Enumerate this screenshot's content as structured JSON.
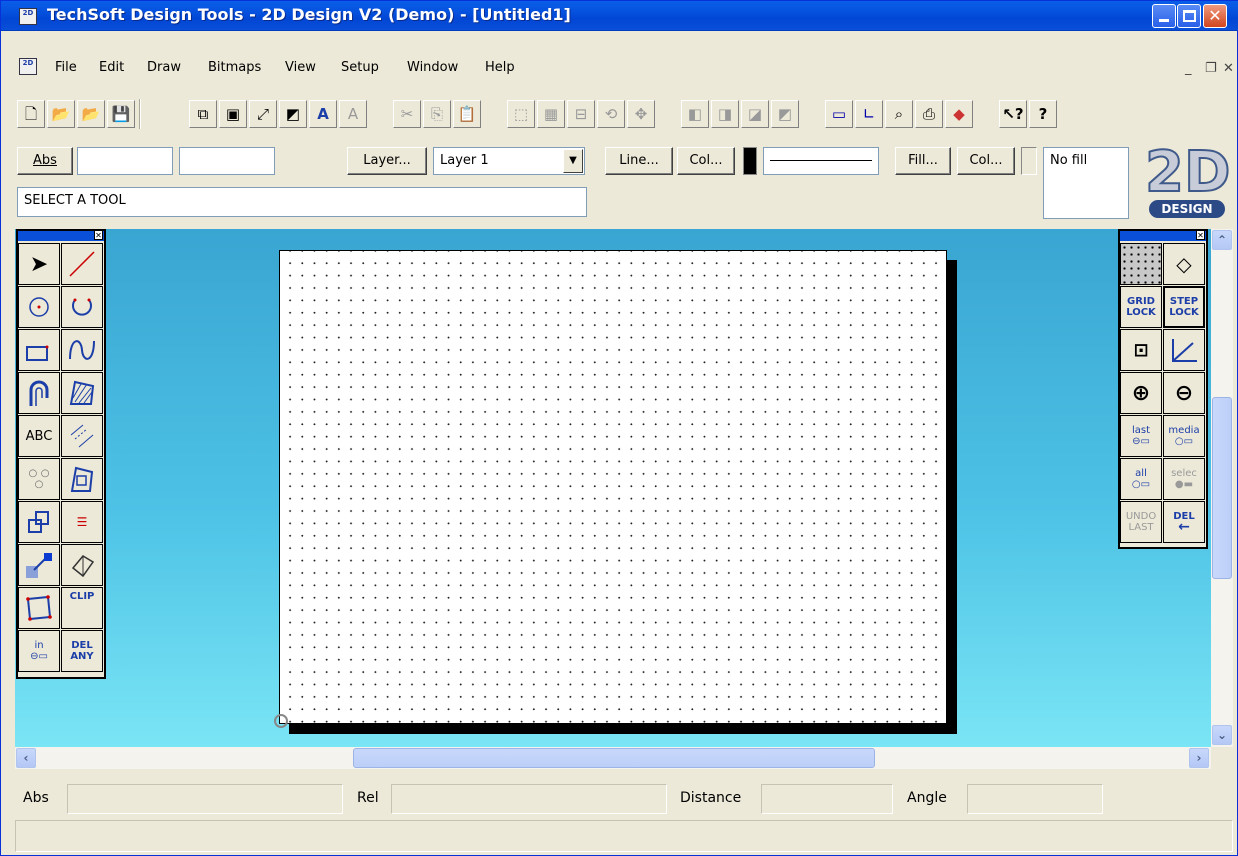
{
  "window": {
    "title": "TechSoft Design Tools - 2D Design V2 (Demo) - [Untitled1]",
    "app_icon": "2D"
  },
  "menu": {
    "items": [
      "File",
      "Edit",
      "Draw",
      "Bitmaps",
      "View",
      "Setup",
      "Window",
      "Help"
    ]
  },
  "toolbar": {
    "icons": [
      "new-file-icon",
      "open-file-icon",
      "open-add-icon",
      "save-icon",
      "zoom-window-icon",
      "zoom-fit-icon",
      "zoom-in-icon",
      "zoom-extents-icon",
      "text-icon",
      "text-disabled-icon",
      "cut-icon",
      "copy-icon",
      "paste-icon",
      "select-all-icon",
      "grid-icon",
      "align-icon",
      "rotate-icon",
      "move-icon",
      "layer-front-icon",
      "layer-back-icon",
      "layer-up-icon",
      "layer-down-icon",
      "screen-icon",
      "axes-icon",
      "magnify-icon",
      "print-icon",
      "export-icon",
      "help-pointer-icon",
      "help-icon"
    ]
  },
  "props": {
    "abs_label": "Abs",
    "x_value": "",
    "y_value": "",
    "layer_button": "Layer...",
    "layer_value": "Layer 1",
    "line_button": "Line...",
    "line_col_button": "Col...",
    "fill_button": "Fill...",
    "fill_col_button": "Col...",
    "fill_value": "No fill",
    "prompt": "SELECT A TOOL"
  },
  "logo": {
    "main": "2D",
    "sub": "DESIGN"
  },
  "left_palette": {
    "tools": [
      {
        "name": "select-arrow-icon",
        "label": ""
      },
      {
        "name": "line-tool-icon",
        "label": ""
      },
      {
        "name": "circle-tool-icon",
        "label": ""
      },
      {
        "name": "arc-tool-icon",
        "label": ""
      },
      {
        "name": "rectangle-tool-icon",
        "label": ""
      },
      {
        "name": "curve-tool-icon",
        "label": ""
      },
      {
        "name": "offset-tool-icon",
        "label": ""
      },
      {
        "name": "hatch-tool-icon",
        "label": ""
      },
      {
        "name": "text-tool-icon",
        "label": "ABC"
      },
      {
        "name": "dimension-tool-icon",
        "label": ""
      },
      {
        "name": "points-tool-icon",
        "label": ""
      },
      {
        "name": "trim-tool-icon",
        "label": ""
      },
      {
        "name": "copy-transform-icon",
        "label": ""
      },
      {
        "name": "array-tool-icon",
        "label": ""
      },
      {
        "name": "bitmap-tool-icon",
        "label": ""
      },
      {
        "name": "solid-tool-icon",
        "label": ""
      },
      {
        "name": "polygon-tool-icon",
        "label": ""
      },
      {
        "name": "clip-tool-icon",
        "label": "CLIP"
      },
      {
        "name": "select-in-icon",
        "label": "in"
      },
      {
        "name": "delete-any-icon",
        "label": "DEL ANY"
      }
    ]
  },
  "right_palette": {
    "tools": [
      {
        "name": "grid-dots-icon",
        "label": ""
      },
      {
        "name": "lasso-icon",
        "label": ""
      },
      {
        "name": "grid-lock-button",
        "label": "GRID LOCK"
      },
      {
        "name": "step-lock-button",
        "label": "STEP LOCK"
      },
      {
        "name": "snap-icon",
        "label": ""
      },
      {
        "name": "axes-snap-icon",
        "label": ""
      },
      {
        "name": "zoom-in-icon",
        "label": ""
      },
      {
        "name": "zoom-out-icon",
        "label": ""
      },
      {
        "name": "select-last-button",
        "label": "last"
      },
      {
        "name": "select-media-button",
        "label": "media"
      },
      {
        "name": "select-all-button",
        "label": "all"
      },
      {
        "name": "select-selec-button",
        "label": "selec"
      },
      {
        "name": "undo-last-button",
        "label": "UNDO LAST"
      },
      {
        "name": "delete-back-button",
        "label": "DEL"
      }
    ]
  },
  "status": {
    "abs_label": "Abs",
    "rel_label": "Rel",
    "distance_label": "Distance",
    "angle_label": "Angle",
    "abs_value": "",
    "rel_value": "",
    "distance_value": "",
    "angle_value": ""
  },
  "colors": {
    "title_blue": "#0a5ee8",
    "canvas_top": "#39a5d2",
    "canvas_bottom": "#7ae5f5",
    "chrome": "#ece9d8"
  }
}
